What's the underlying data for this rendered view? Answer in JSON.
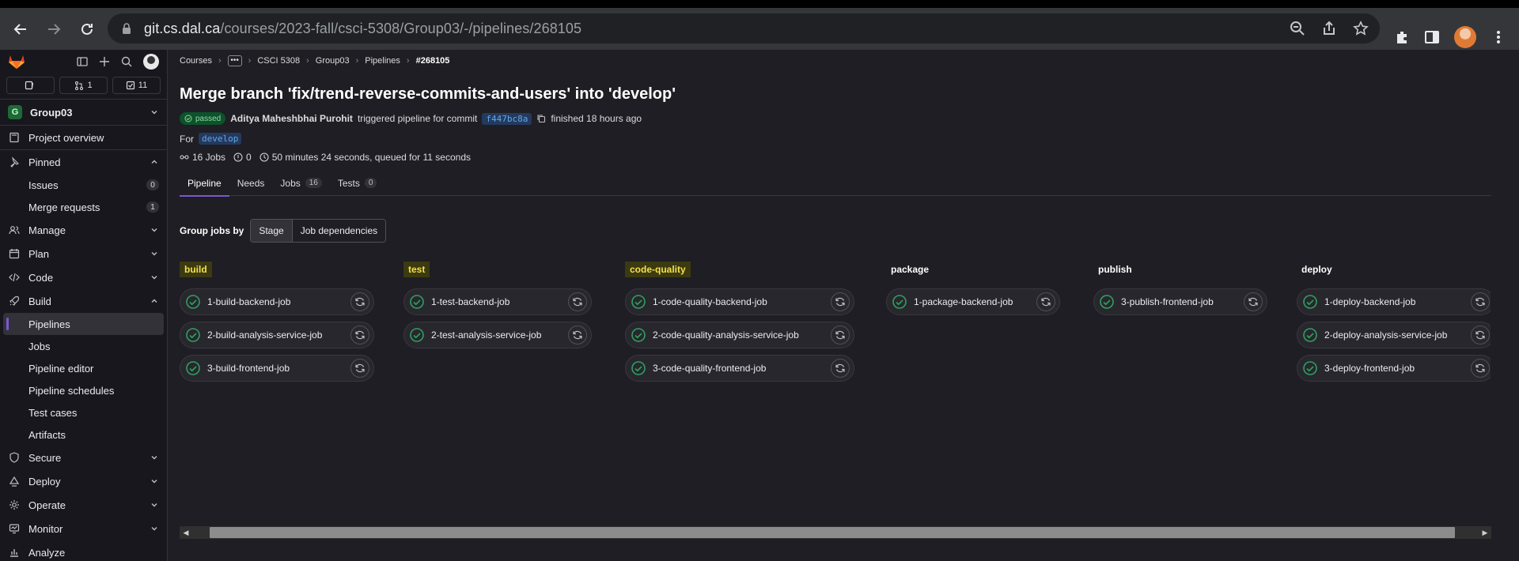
{
  "browser": {
    "url_host": "git.cs.dal.ca",
    "url_path": "/courses/2023-fall/csci-5308/Group03/-/pipelines/268105"
  },
  "sidebar": {
    "counters": [
      {
        "icon": "issues-icon",
        "value": ""
      },
      {
        "icon": "merge-request-icon",
        "value": "1"
      },
      {
        "icon": "todo-icon",
        "value": "11"
      }
    ],
    "group": {
      "avatar": "G",
      "name": "Group03"
    },
    "project_overview": "Project overview",
    "pinned": {
      "label": "Pinned",
      "items": [
        {
          "label": "Issues",
          "count": "0"
        },
        {
          "label": "Merge requests",
          "count": "1"
        }
      ]
    },
    "manage": "Manage",
    "plan": "Plan",
    "code": "Code",
    "build": {
      "label": "Build",
      "items": [
        "Pipelines",
        "Jobs",
        "Pipeline editor",
        "Pipeline schedules",
        "Test cases",
        "Artifacts"
      ]
    },
    "secure": "Secure",
    "deploy": "Deploy",
    "operate": "Operate",
    "monitor": "Monitor",
    "analyze": "Analyze"
  },
  "breadcrumbs": [
    "Courses",
    "CSCI 5308",
    "Group03",
    "Pipelines",
    "#268105"
  ],
  "page": {
    "title": "Merge branch 'fix/trend-reverse-commits-and-users' into 'develop'",
    "status": "passed",
    "author": "Aditya Maheshbhai Purohit",
    "trigger_text": "triggered pipeline for commit",
    "commit": "f447bc8a",
    "finished": "finished 18 hours ago",
    "for_label": "For",
    "branch": "develop",
    "jobs_count": "16 Jobs",
    "warnings": "0",
    "duration": "50 minutes 24 seconds, queued for 11 seconds"
  },
  "tabs": [
    {
      "label": "Pipeline",
      "count": null
    },
    {
      "label": "Needs",
      "count": null
    },
    {
      "label": "Jobs",
      "count": "16"
    },
    {
      "label": "Tests",
      "count": "0"
    }
  ],
  "groupby": {
    "label": "Group jobs by",
    "options": [
      "Stage",
      "Job dependencies"
    ],
    "selected": "Stage"
  },
  "stages": [
    {
      "name": "build",
      "highlight": true,
      "jobs": [
        "1-build-backend-job",
        "2-build-analysis-service-job",
        "3-build-frontend-job"
      ]
    },
    {
      "name": "test",
      "highlight": true,
      "jobs": [
        "1-test-backend-job",
        "2-test-analysis-service-job"
      ]
    },
    {
      "name": "code-quality",
      "highlight": true,
      "jobs": [
        "1-code-quality-backend-job",
        "2-code-quality-analysis-service-job",
        "3-code-quality-frontend-job"
      ]
    },
    {
      "name": "package",
      "highlight": false,
      "jobs": [
        "1-package-backend-job"
      ]
    },
    {
      "name": "publish",
      "highlight": false,
      "jobs": [
        "3-publish-frontend-job"
      ]
    },
    {
      "name": "deploy",
      "highlight": false,
      "jobs": [
        "1-deploy-backend-job",
        "2-deploy-analysis-service-job",
        "3-deploy-frontend-job"
      ]
    }
  ]
}
